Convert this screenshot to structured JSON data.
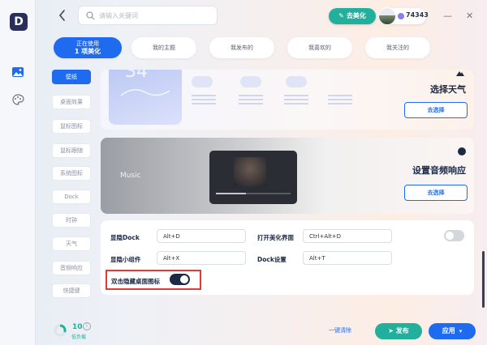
{
  "app": {
    "logo_letter": "D"
  },
  "rail": {
    "items": [
      {
        "icon": "image-icon"
      },
      {
        "icon": "palette-icon"
      }
    ]
  },
  "header": {
    "search": {
      "placeholder": "请输入关键词",
      "value": ""
    },
    "beautify_label": "去美化",
    "points": "74343",
    "win_minimize": "—",
    "win_close": "✕"
  },
  "tabs": {
    "active_line1": "正在使用",
    "active_line2": "1 项美化",
    "items": [
      "我的主题",
      "我发布的",
      "我喜欢的",
      "我关注的"
    ]
  },
  "sidebar": {
    "items": [
      "壁纸",
      "桌面效果",
      "鼠标图标",
      "鼠标跟随",
      "系统图标",
      "Dock",
      "时钟",
      "天气",
      "音频响应",
      "快捷键"
    ],
    "active_index": 0
  },
  "weather_card": {
    "preview_number": "34",
    "title": "选择天气",
    "button": "去选择"
  },
  "audio_card": {
    "preview_label": "Music",
    "title": "设置音频响应",
    "button": "去选择"
  },
  "settings": {
    "toggle_dock_label": "显隐Dock",
    "toggle_dock_key": "Alt+D",
    "open_ui_label": "打开美化界面",
    "open_ui_key": "Ctrl+Alt+D",
    "toggle_widget_label": "显隐小组件",
    "toggle_widget_key": "Alt+X",
    "dock_settings_label": "Dock设置",
    "dock_settings_key": "Alt+T",
    "double_click_label": "双击隐藏桌面图标",
    "double_click_on": true,
    "open_ui_toggle_on": false
  },
  "footer": {
    "load_value": "10",
    "load_label": "低负载",
    "info_glyph": "i",
    "clear_label": "一键清除",
    "publish_label": "发布",
    "apply_label": "应用"
  },
  "colors": {
    "accent": "#1e6bf0",
    "teal": "#22b09c",
    "dark": "#1d2a44",
    "highlight": "#e53935"
  }
}
